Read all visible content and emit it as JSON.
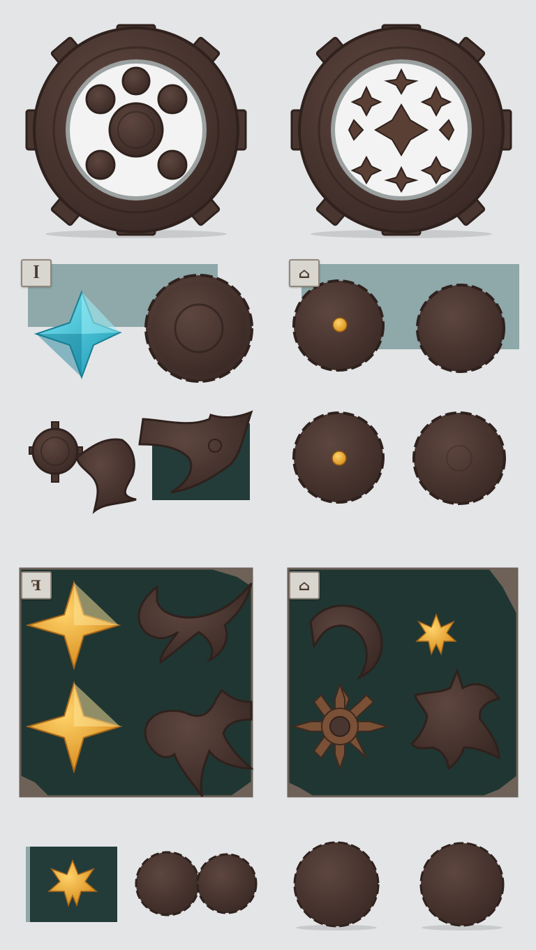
{
  "sheet": {
    "background": "#e4e5e7",
    "wood_color": "#4a3631",
    "wood_dark": "#2f211d",
    "gem_blue": "#3cc6dc",
    "gem_gold": "#f0a92d",
    "panel_teal": "#8fa8aa",
    "panel_dark": "#233c39"
  },
  "badges": {
    "badge_1": "ꟾ",
    "badge_2": "⌂",
    "badge_3": "ꟻ",
    "badge_4": "⌂"
  },
  "icons": [
    "gear-wheel-with-studs",
    "gear-wheel-with-spikes",
    "blue-star-gem",
    "wooden-shield",
    "gold-star-gem",
    "wooden-claw",
    "shuriken-cross"
  ]
}
